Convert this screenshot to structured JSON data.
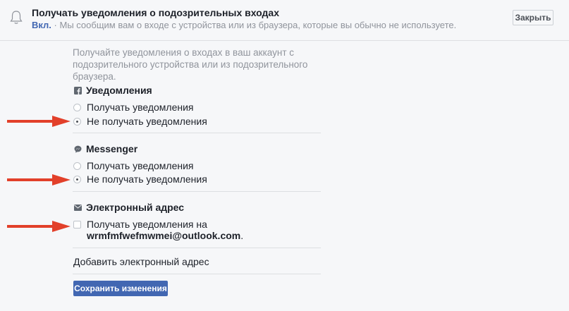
{
  "header": {
    "title": "Получать уведомления о подозрительных входах",
    "status": "Вкл.",
    "separator": " · ",
    "subtitle": "Мы сообщим вам о входе с устройства или из браузера, которые вы обычно не используете.",
    "close_label": "Закрыть",
    "icon": "bell-icon"
  },
  "description": "Получайте уведомления о входах в ваш аккаунт с подозрительного устройства или из подозрительного браузера.",
  "sections": {
    "notifications": {
      "title": "Уведомления",
      "icon": "facebook-icon",
      "options": [
        "Получать уведомления",
        "Не получать уведомления"
      ],
      "selected": "Не получать уведомления"
    },
    "messenger": {
      "title": "Messenger",
      "icon": "messenger-icon",
      "options": [
        "Получать уведомления",
        "Не получать уведомления"
      ],
      "selected": "Не получать уведомления"
    },
    "email": {
      "title": "Электронный адрес",
      "icon": "envelope-icon",
      "checkbox_label": "Получать уведомления на",
      "address": "wrmfmfwefmwmei@outlook.com",
      "address_suffix": ".",
      "checked": false,
      "add_label": "Добавить электронный адрес"
    }
  },
  "save_label": "Сохранить изменения",
  "colors": {
    "accent": "#4267b2",
    "annotation_arrow": "#e2402a",
    "muted_text": "#90949c",
    "background": "#f6f7f9"
  }
}
